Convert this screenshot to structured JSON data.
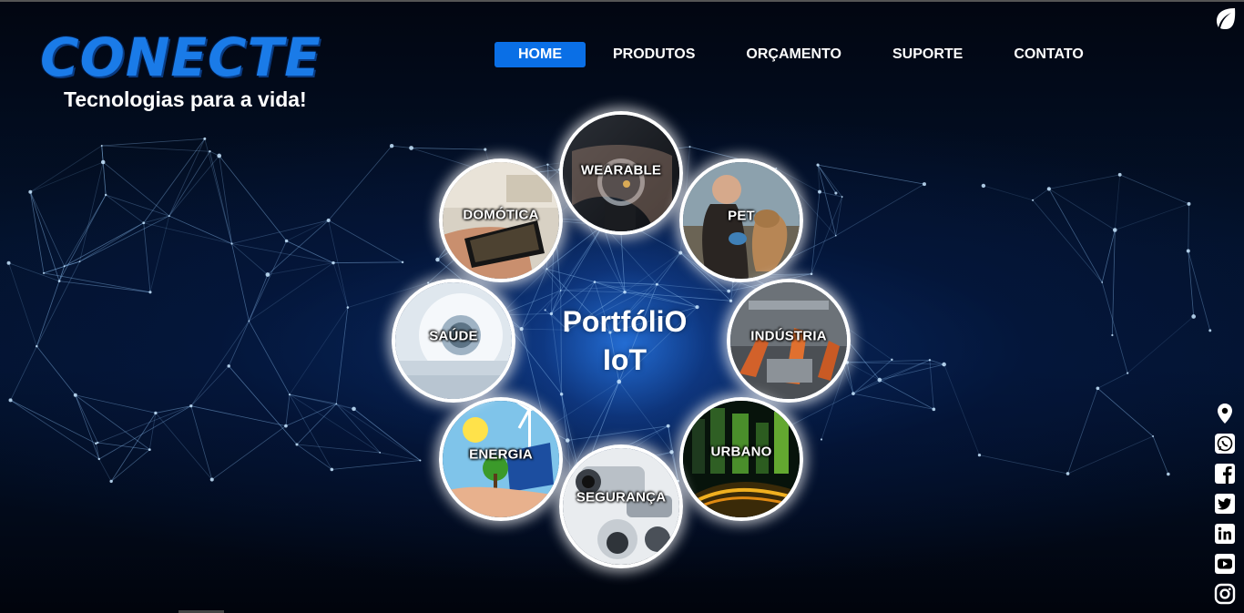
{
  "brand": {
    "title": "CONECTE",
    "tagline": "Tecnologias para a vida!"
  },
  "nav": {
    "items": [
      {
        "label": "HOME",
        "active": true
      },
      {
        "label": "PRODUTOS",
        "active": false
      },
      {
        "label": "ORÇAMENTO",
        "active": false
      },
      {
        "label": "SUPORTE",
        "active": false
      },
      {
        "label": "CONTATO",
        "active": false
      }
    ]
  },
  "portfolio": {
    "line1": "PortfóliO",
    "line2": "IoT",
    "categories": [
      {
        "label": "WEARABLE"
      },
      {
        "label": "PET"
      },
      {
        "label": "INDÚSTRIA"
      },
      {
        "label": "URBANO"
      },
      {
        "label": "SEGURANÇA"
      },
      {
        "label": "ENERGIA"
      },
      {
        "label": "SAÚDE"
      },
      {
        "label": "DOMÓTICA"
      }
    ]
  },
  "social": [
    "location-icon",
    "whatsapp-icon",
    "facebook-icon",
    "twitter-icon",
    "linkedin-icon",
    "youtube-icon",
    "instagram-icon"
  ],
  "colors": {
    "accent": "#0a6fe6",
    "logo": "#1a7be8",
    "background": "#03122b"
  }
}
